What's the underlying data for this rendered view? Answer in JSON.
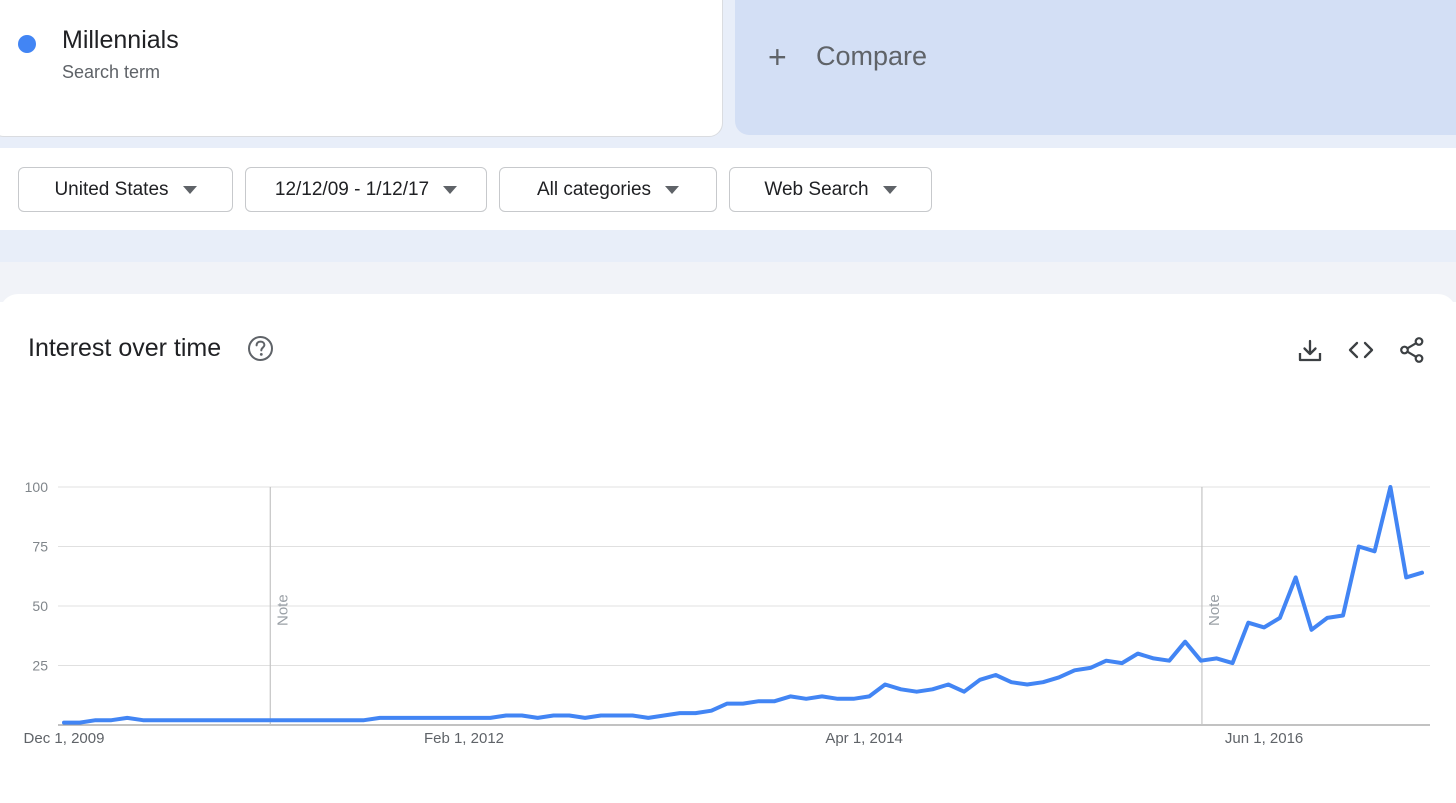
{
  "search_term": {
    "name": "Millennials",
    "subtitle": "Search term",
    "color": "#4285f4"
  },
  "compare": {
    "label": "Compare",
    "icon": "plus-icon"
  },
  "filters": [
    {
      "label": "United States"
    },
    {
      "label": "12/12/09 - 1/12/17"
    },
    {
      "label": "All categories"
    },
    {
      "label": "Web Search"
    }
  ],
  "panel": {
    "title": "Interest over time",
    "help_icon": "help-icon",
    "tools": [
      "download-icon",
      "embed-code-icon",
      "share-icon"
    ]
  },
  "chart_data": {
    "type": "line",
    "x_tick_labels": [
      "Dec 1, 2009",
      "Feb 1, 2012",
      "Apr 1, 2014",
      "Jun 1, 2016"
    ],
    "y_ticks": [
      25,
      50,
      75,
      100
    ],
    "ylim": [
      0,
      100
    ],
    "grid": true,
    "series": [
      {
        "color": "#4285f4",
        "values": [
          1,
          1,
          2,
          2,
          3,
          2,
          2,
          2,
          2,
          2,
          2,
          2,
          2,
          2,
          2,
          2,
          2,
          2,
          2,
          2,
          3,
          3,
          3,
          3,
          3,
          3,
          3,
          3,
          4,
          4,
          3,
          4,
          4,
          3,
          4,
          4,
          4,
          3,
          4,
          5,
          5,
          6,
          9,
          9,
          10,
          10,
          12,
          11,
          12,
          11,
          11,
          12,
          17,
          15,
          14,
          15,
          17,
          14,
          19,
          21,
          18,
          17,
          18,
          20,
          23,
          24,
          27,
          26,
          30,
          28,
          27,
          35,
          27,
          28,
          26,
          43,
          41,
          45,
          62,
          40,
          45,
          46,
          75,
          73,
          100,
          62,
          64
        ]
      }
    ],
    "annotations": [
      {
        "label": "Note",
        "index": 13
      },
      {
        "label": "Note",
        "index": 72
      }
    ]
  }
}
